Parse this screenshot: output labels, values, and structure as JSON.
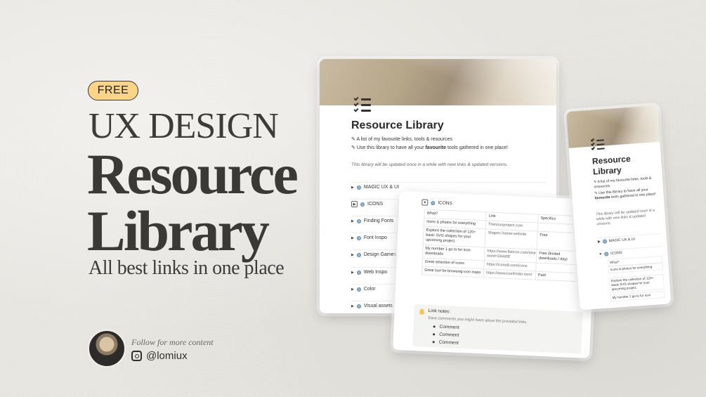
{
  "hero": {
    "badge": "FREE",
    "line1": "UX DESIGN",
    "line2": "Resource",
    "line3": "Library",
    "subtitle": "All best links in one place",
    "follow_text": "Follow for more content",
    "handle": "@lomiux"
  },
  "main_card": {
    "title": "Resource Library",
    "desc1": "A list of my favourite links, tools & resources",
    "desc2_pre": "Use this library to have all your ",
    "desc2_bold": "favourite",
    "desc2_post": " tools gathered in one place!",
    "note": "This library will be updated once in a while with new links & updated versions.",
    "sections": [
      "MAGIC UX & UI",
      "ICONS",
      "Finding Fonts",
      "Font Inspo",
      "Design Games",
      "Web Inspo",
      "Color",
      "Visual assets"
    ]
  },
  "icons_card": {
    "header": "ICONS",
    "columns": [
      "What?",
      "Link",
      "Specifics"
    ],
    "rows": [
      {
        "what": "Icons & photos for everything",
        "link": "Thenounproject.com",
        "spec": ""
      },
      {
        "what": "Explore the collection of 120+ basic SVG shapes for your upcoming project.",
        "link": "Shapes.framer.website",
        "spec": "Free"
      },
      {
        "what": "My number 1 go to for icon downloads",
        "link": "https://www.flaticon.com/search?word=SHARE",
        "spec": "Free (limited downloads / day)"
      },
      {
        "what": "Great selection of icons",
        "link": "https://iconsB.com/icons",
        "spec": ""
      },
      {
        "what": "Great tool for browsing icon inspo",
        "link": "https://www.iconfinder.com/",
        "spec": "Paid"
      }
    ],
    "callout_title": "Link notes:",
    "callout_sub": "Save comments you might have about the provided links.",
    "comments": [
      "Comment",
      "Comment",
      "Comment"
    ]
  },
  "mobile_card": {
    "title": "Resource Library",
    "desc1": "A list of my favourite links, tools & resources",
    "desc2_pre": "Use this library to have all your ",
    "desc2_bold": "favourite",
    "desc2_post": " tools gathered in one place!",
    "note": "This library will be updated once in a while with new links & updated versions.",
    "sec1": "MAGIC UX & UI",
    "sec2": "ICONS",
    "what": "What?",
    "c1": "Icons & photos for everything",
    "c2": "Explore the collection of 120+ basic SVG shapes for your upcoming project.",
    "c3": "My number 1 go to for icon"
  },
  "colors": {
    "badge": "#fbd488",
    "text_dark": "#3a3936",
    "paid": "#a7472f"
  }
}
